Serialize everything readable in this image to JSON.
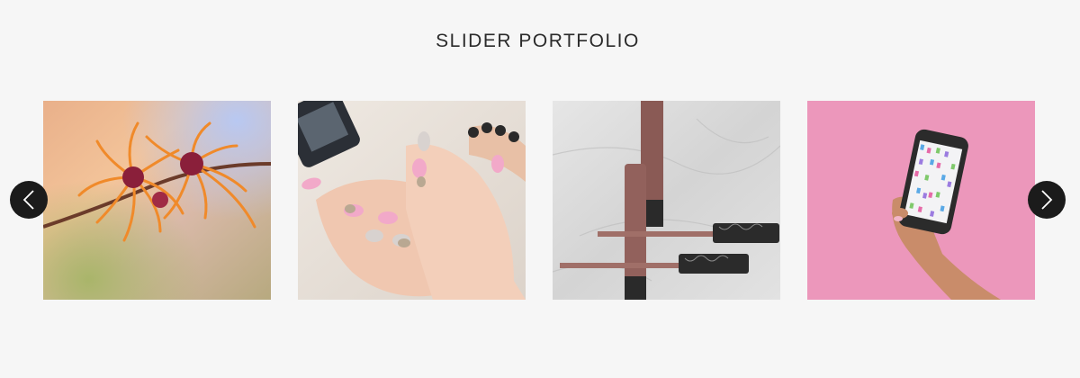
{
  "section": {
    "title": "SLIDER PORTFOLIO"
  },
  "slider": {
    "prev_icon": "chevron-left-icon",
    "next_icon": "chevron-right-icon",
    "slides": [
      {
        "subject": "witch-hazel-flower-photo"
      },
      {
        "subject": "manicured-nails-photo"
      },
      {
        "subject": "lip-gloss-tubes-photo"
      },
      {
        "subject": "hand-holding-phone-photo"
      }
    ]
  },
  "colors": {
    "background": "#f6f6f6",
    "arrow_bg": "#1b1b1b",
    "arrow_icon": "#ffffff",
    "title": "#2b2b2b"
  }
}
